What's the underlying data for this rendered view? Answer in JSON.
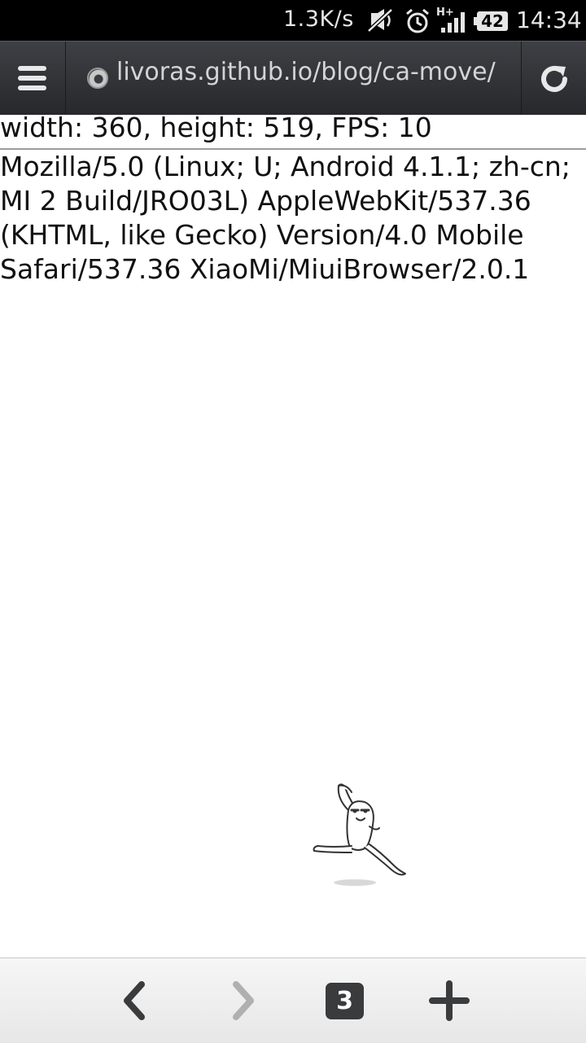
{
  "status_bar": {
    "net_speed": "1.3K/s",
    "network_type": "H+",
    "battery_level": "42",
    "time": "14:34",
    "icons": [
      "mute-icon",
      "alarm-icon",
      "signal-icon",
      "battery-icon"
    ]
  },
  "toolbar": {
    "url": "livoras.github.io/blog/ca-move/",
    "icons": [
      "menu-icon",
      "site-icon",
      "reload-icon"
    ]
  },
  "page": {
    "fps_info": "width: 360, height: 519, FPS: 10",
    "user_agent": "Mozilla/5.0 (Linux; U; Android 4.1.1; zh-cn; MI 2 Build/JRO03L) AppleWebKit/537.36 (KHTML, like Gecko) Version/4.0 Mobile Safari/537.36 XiaoMi/MiuiBrowser/2.0.1",
    "animation_sprite": "running-character"
  },
  "bottom_bar": {
    "tab_count": "3",
    "forward_enabled": false,
    "icons": [
      "back-icon",
      "forward-icon",
      "tabs-icon",
      "new-tab-icon"
    ]
  },
  "colors": {
    "toolbar_bg": "#2f3135",
    "status_bar_bg": "#000000",
    "bottom_bar_bg": "#eeeeee",
    "disabled_icon": "#b0b0b0"
  }
}
